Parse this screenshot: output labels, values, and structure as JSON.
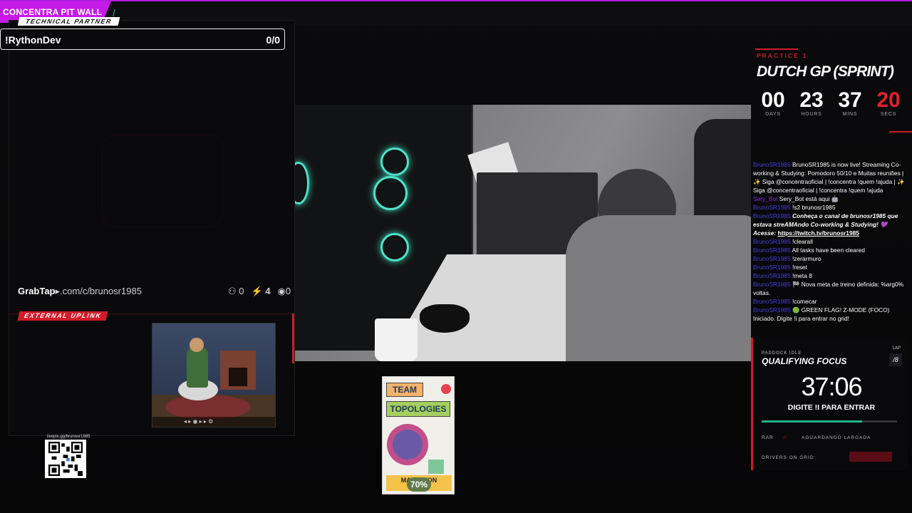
{
  "header": {
    "brand": "CONCENTRA PIT WALL",
    "technical_partner": "TECHNICAL PARTNER",
    "slash": "/"
  },
  "left_panel": {
    "name": "!RythonDev",
    "count": "0/0",
    "grabtap_logo": "GrabTap",
    "grabtap_url": ".com/c/brunosr1985",
    "stat_users": "0",
    "stat_bolt": "4",
    "stat_cyan": "0",
    "external_uplink": "EXTERNAL UPLINK",
    "qr_label": "livepix.gg/brunosr1985"
  },
  "book": {
    "title_1": "TEAM",
    "title_2": "TOPOLOGIES",
    "author": "MATT     LTON",
    "progress": "70%"
  },
  "right_panel": {
    "session": "PRACTICE 1",
    "race": "DUTCH GP (SPRINT)",
    "countdown": [
      {
        "value": "00",
        "label": "DAYS"
      },
      {
        "value": "23",
        "label": "HOURS"
      },
      {
        "value": "37",
        "label": "MINS"
      },
      {
        "value": "20",
        "label": "SECS"
      }
    ],
    "chat": [
      {
        "user": "BrunoSR1985",
        "text": "BrunoSR1985 is now live! Streaming Co-working & Studying: Pomodoro 50/10 e Muitas reuniões | ✨ Siga @concentraoficial | !concentra !quem !ajuda | ✨ Siga @concentraoficial | !concentra !quem !ajuda"
      },
      {
        "user": "Sery_Bot",
        "text": "Sery_Bot está aqui 🤖"
      },
      {
        "user": "BrunoSR1985",
        "text": "!s2 brunosr1985"
      },
      {
        "user": "BrunoSR1985",
        "text": "Conheça o canal de brunosr1985 que estava streAMAndo Co-working & Studying! 💜 Acesse:",
        "link": "https://twitch.tv/brunosr1985"
      },
      {
        "user": "BrunoSR1985",
        "text": "!clearall"
      },
      {
        "user": "BrunoSR1985",
        "text": "All tasks have been cleared"
      },
      {
        "user": "BrunoSR1985",
        "text": "!zerarmuro"
      },
      {
        "user": "BrunoSR1985",
        "text": "!reset"
      },
      {
        "user": "BrunoSR1985",
        "text": "!meta 8"
      },
      {
        "user": "BrunoSR1985",
        "text": "🏁 Nova meta de treino definida: %arg0% voltas."
      },
      {
        "user": "BrunoSR1985",
        "text": "!comecar"
      },
      {
        "user": "BrunoSR1985",
        "text": "🟢 GREEN FLAG! Z-MODE (FOCO) Iniciado. Digite !i para entrar no grid!"
      }
    ],
    "paddock": "PADDOCK IDLE",
    "lap_label": "LAP",
    "qualifying": "QUALIFYING FOCUS",
    "lap_value": "/8",
    "timer": "37:06",
    "prompt": "DIGITE !I PARA ENTRAR",
    "timer_progress": 0.74,
    "rar": "RAR",
    "sep": "///",
    "awaiting": "AGUARDANDO LARGADA",
    "drivers": "DRIVERS ON GRID:"
  },
  "colors": {
    "brand": "#c41ce6",
    "accent_red": "#d01b2a",
    "accent_green": "#1eb48a"
  }
}
